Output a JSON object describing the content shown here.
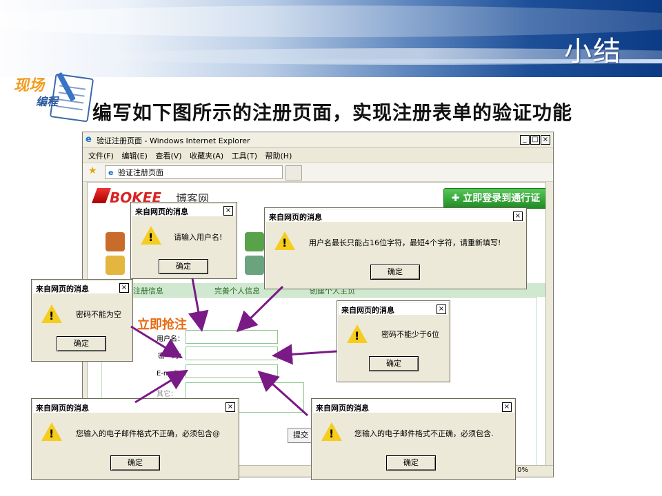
{
  "slide": {
    "title": "小结",
    "badge_line1": "现场",
    "badge_line2": "编程",
    "subtitle": "编写如下图所示的注册页面，实现注册表单的验证功能"
  },
  "browser": {
    "window_title": "验证注册页面 - Windows Internet Explorer",
    "menus": [
      "文件(F)",
      "编辑(E)",
      "查看(V)",
      "收藏夹(A)",
      "工具(T)",
      "帮助(H)"
    ],
    "tab_title": "验证注册页面",
    "status_zoom": "0%"
  },
  "page": {
    "logo": "BOKEE",
    "logo_cn": "博客网",
    "register_button": "立即登录到通行证",
    "tab_label_1": "注册信息",
    "tab_label_2": "完善个人信息",
    "tab_label_3": "创建个人主页",
    "heading": "立即抢注",
    "labels": {
      "username": "用户名：",
      "password": "密　码：",
      "email": "E-mail：",
      "extra": "其它："
    },
    "submit": "提交"
  },
  "dialogs": [
    {
      "title": "来自网页的消息",
      "message": "请输入用户名!",
      "ok": "确定"
    },
    {
      "title": "来自网页的消息",
      "message": "用户名最长只能占16位字符，最短4个字符，请重新填写!",
      "ok": "确定"
    },
    {
      "title": "来自网页的消息",
      "message": "密码不能为空",
      "ok": "确定"
    },
    {
      "title": "来自网页的消息",
      "message": "密码不能少于6位",
      "ok": "确定"
    },
    {
      "title": "来自网页的消息",
      "message": "您输入的电子邮件格式不正确，必须包含@",
      "ok": "确定"
    },
    {
      "title": "来自网页的消息",
      "message": "您输入的电子邮件格式不正确，必须包含.",
      "ok": "确定"
    }
  ],
  "colors": {
    "banner_dark": "#0c3b85",
    "arrow": "#7a1a86",
    "accent_orange": "#e86a10",
    "green": "#1e8d23"
  }
}
